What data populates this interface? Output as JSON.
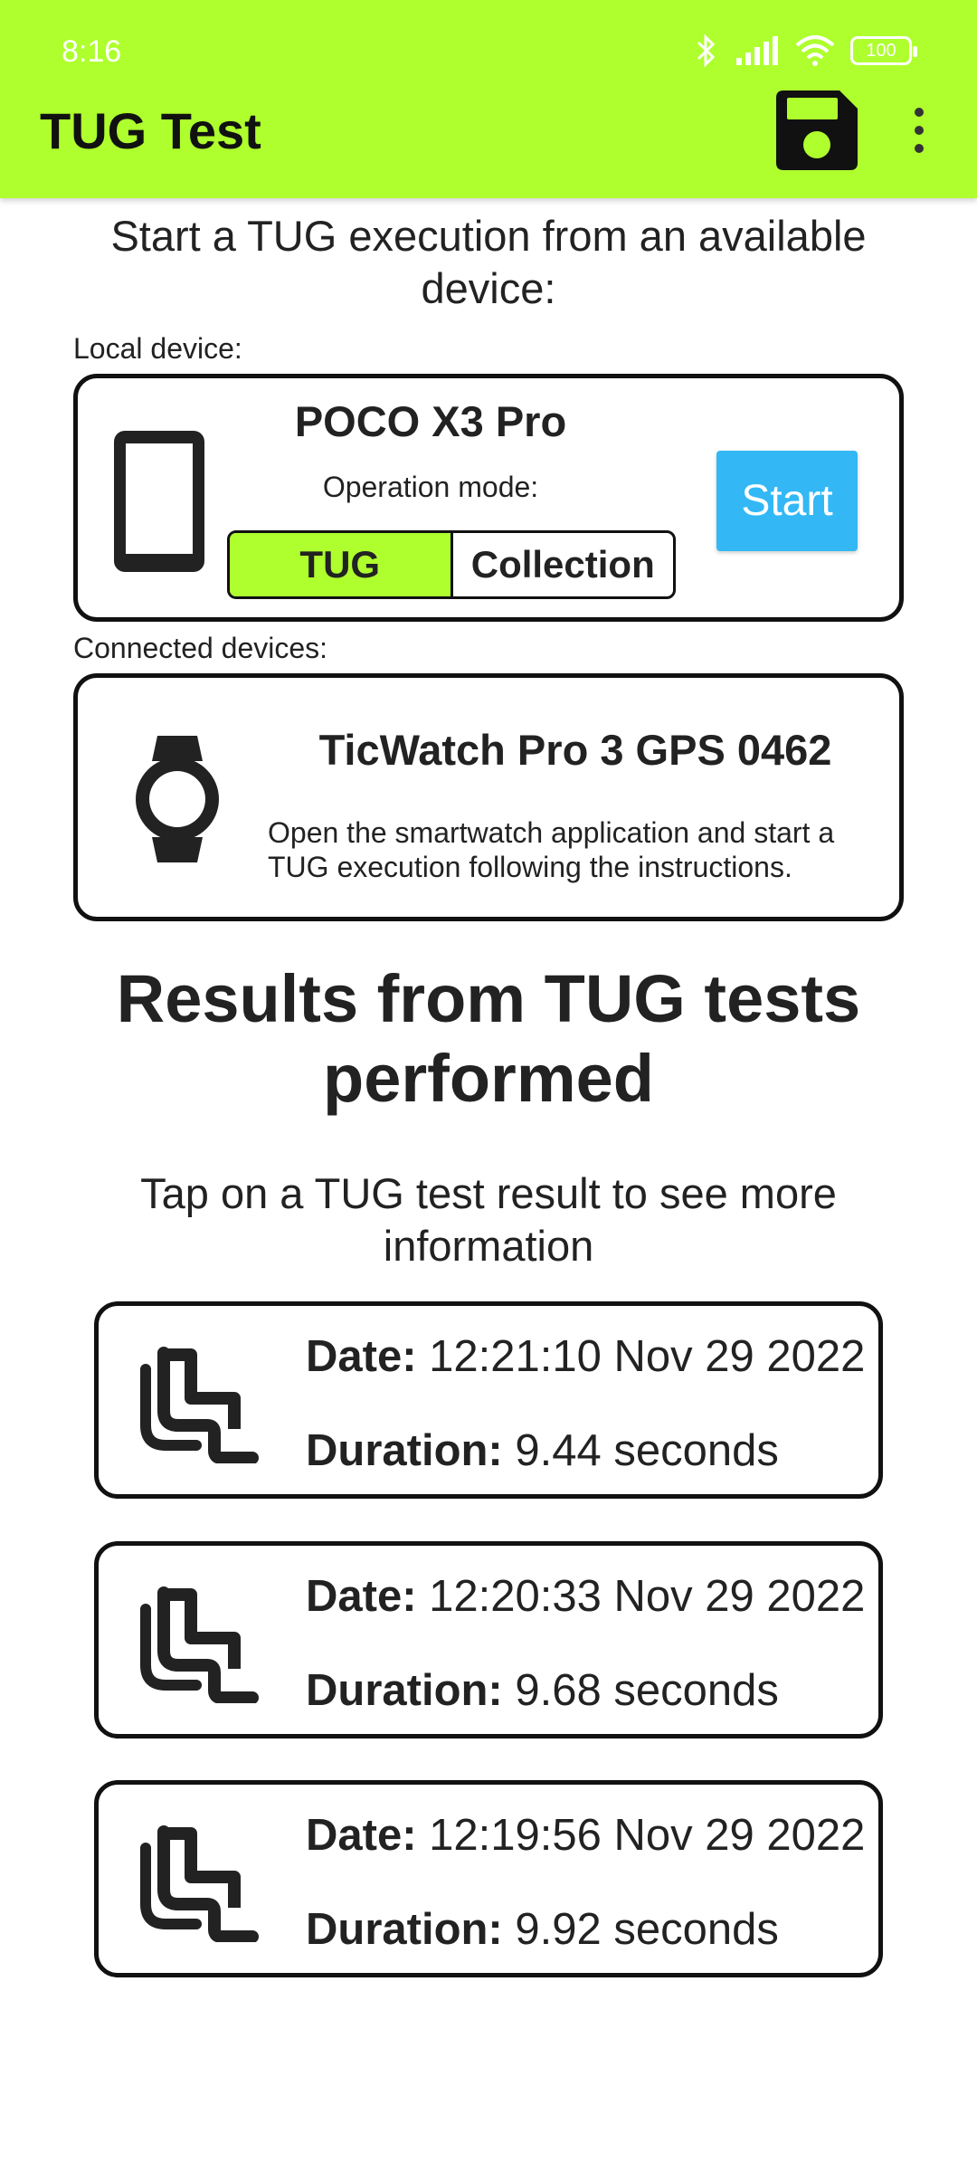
{
  "status_bar": {
    "time": "8:16",
    "battery": "100",
    "icons": [
      "bluetooth-icon",
      "signal-icon",
      "wifi-icon",
      "battery-icon"
    ]
  },
  "appbar": {
    "title": "TUG Test",
    "background": "#aeff2d",
    "save_icon": "save-icon",
    "more_icon": "more-vert-icon"
  },
  "intro": "Start a TUG execution from an available device:",
  "local": {
    "section_label": "Local device:",
    "device_name": "POCO X3 Pro",
    "operation_mode_label": "Operation mode:",
    "modes": [
      "TUG",
      "Collection"
    ],
    "selected_mode": "TUG",
    "start_label": "Start",
    "icon": "phone-icon"
  },
  "connected": {
    "section_label": "Connected devices:",
    "device_name": "TicWatch Pro 3 GPS 0462",
    "instructions": "Open the smartwatch application and start a TUG execution following the instructions.",
    "icon": "watch-icon"
  },
  "results": {
    "title": "Results from TUG tests performed",
    "hint": "Tap on a TUG test result to see more information",
    "date_label": "Date:",
    "duration_label": "Duration:",
    "items": [
      {
        "date": "12:21:10 Nov 29 2022",
        "duration": "9.44 seconds"
      },
      {
        "date": "12:20:33 Nov 29 2022",
        "duration": "9.68 seconds"
      },
      {
        "date": "12:19:56 Nov 29 2022",
        "duration": "9.92 seconds"
      }
    ]
  },
  "colors": {
    "accent": "#aeff2d",
    "start_button": "#33b8f5"
  }
}
